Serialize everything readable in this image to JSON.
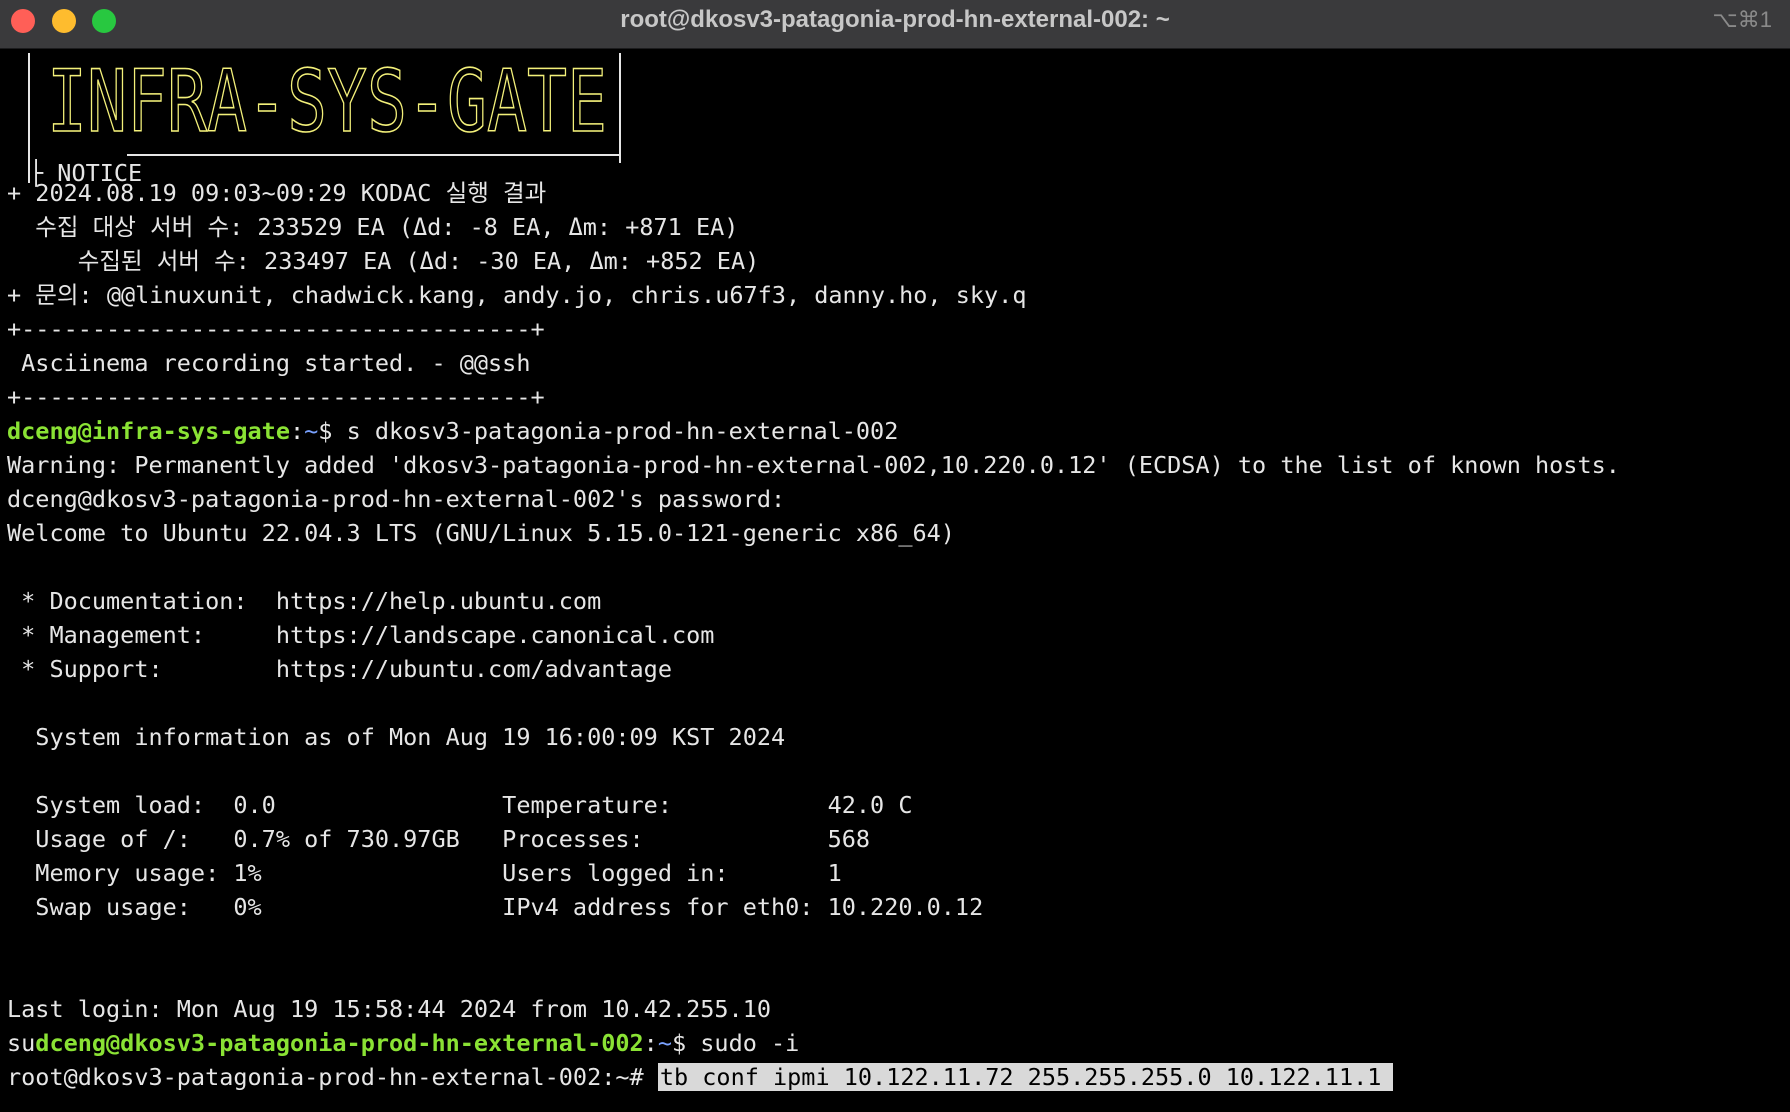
{
  "window": {
    "title": "root@dkosv3-patagonia-prod-hn-external-002: ~",
    "shortcut": "⌥⌘1"
  },
  "banner": {
    "logo_text": "INFRA-SYS-GATE",
    "notice_label": "NOTICE",
    "logo_color": "#f3f07a"
  },
  "terminal": {
    "notice_l1": "+ 2024.08.19 09:03~09:29 KODAC 실행 결과",
    "notice_l2": "  수집 대상 서버 수: 233529 EA (Δd: -8 EA, Δm: +871 EA)",
    "notice_l3": "     수집된 서버 수: 233497 EA (Δd: -30 EA, Δm: +852 EA)",
    "notice_l4": "+ 문의: @@linuxunit, chadwick.kang, andy.jo, chris.u67f3, danny.ho, sky.q",
    "sep1": "+------------------------------------+",
    "asciinema": " Asciinema recording started. - @@ssh",
    "sep2": "+------------------------------------+",
    "p1_user": "dceng@infra-sys-gate",
    "p1_colon": ":",
    "p1_path": "~",
    "p1_cmd": "$ s dkosv3-patagonia-prod-hn-external-002",
    "warning": "Warning: Permanently added 'dkosv3-patagonia-prod-hn-external-002,10.220.0.12' (ECDSA) to the list of known hosts.",
    "password": "dceng@dkosv3-patagonia-prod-hn-external-002's password:",
    "welcome": "Welcome to Ubuntu 22.04.3 LTS (GNU/Linux 5.15.0-121-generic x86_64)",
    "doc": " * Documentation:  https://help.ubuntu.com",
    "mgmt": " * Management:     https://landscape.canonical.com",
    "support": " * Support:        https://ubuntu.com/advantage",
    "sysinfo": "  System information as of Mon Aug 19 16:00:09 KST 2024",
    "stats1": "  System load:  0.0                Temperature:           42.0 C",
    "stats2": "  Usage of /:   0.7% of 730.97GB   Processes:             568",
    "stats3": "  Memory usage: 1%                 Users logged in:       1",
    "stats4": "  Swap usage:   0%                 IPv4 address for eth0: 10.220.0.12",
    "last_login": "Last login: Mon Aug 19 15:58:44 2024 from 10.42.255.10",
    "p2_prefix": "su",
    "p2_user": "dceng@dkosv3-patagonia-prod-hn-external-002",
    "p2_colon": ":",
    "p2_path": "~",
    "p2_cmd": "$ sudo -i",
    "p3_prompt": "root@dkosv3-patagonia-prod-hn-external-002:~# ",
    "p3_cmd": "tb conf ipmi 10.122.11.72 255.255.255.0 10.122.11.1"
  }
}
